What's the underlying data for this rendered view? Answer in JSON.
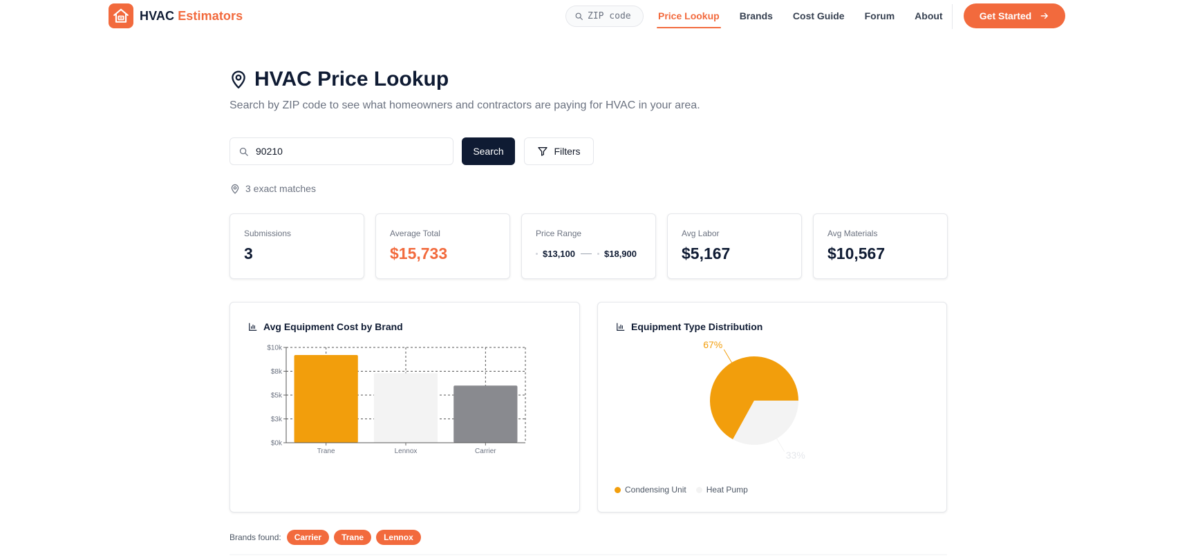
{
  "brand": {
    "name_main": "HVAC",
    "name_accent": "Estimators",
    "logo_icon": "house-icon"
  },
  "nav": {
    "zip_placeholder": "ZIP code",
    "links": [
      {
        "label": "Price Lookup",
        "active": true
      },
      {
        "label": "Brands",
        "active": false
      },
      {
        "label": "Cost Guide",
        "active": false
      },
      {
        "label": "Forum",
        "active": false
      },
      {
        "label": "About",
        "active": false
      }
    ],
    "cta_label": "Get Started"
  },
  "page": {
    "title": "HVAC Price Lookup",
    "subtitle": "Search by ZIP code to see what homeowners and contractors are paying for HVAC in your area."
  },
  "search": {
    "value": "90210",
    "button_label": "Search",
    "filters_label": "Filters"
  },
  "matches_text": "3 exact matches",
  "stats": {
    "submissions": {
      "label": "Submissions",
      "value": "3"
    },
    "average_total": {
      "label": "Average Total",
      "value": "$15,733"
    },
    "price_range": {
      "label": "Price Range",
      "min": "$13,100",
      "max": "$18,900"
    },
    "avg_labor": {
      "label": "Avg Labor",
      "value": "$5,167"
    },
    "avg_materials": {
      "label": "Avg Materials",
      "value": "$10,567"
    }
  },
  "chart_data": [
    {
      "type": "bar",
      "title": "Avg Equipment Cost by Brand",
      "categories": [
        "Trane",
        "Lennox",
        "Carrier"
      ],
      "values": [
        9200,
        7300,
        6000
      ],
      "colors": [
        "#f29e0c",
        "#f3f3f3",
        "#898a8f"
      ],
      "ylim": [
        0,
        10000
      ],
      "yticks": [
        0,
        2500,
        5000,
        7500,
        10000
      ],
      "ytick_labels": [
        "$0k",
        "$3k",
        "$5k",
        "$8k",
        "$10k"
      ],
      "grid": true,
      "xlabel": "",
      "ylabel": ""
    },
    {
      "type": "pie",
      "title": "Equipment Type Distribution",
      "labels": [
        "Condensing Unit",
        "Heat Pump"
      ],
      "values": [
        67,
        33
      ],
      "value_labels": [
        "67%",
        "33%"
      ],
      "colors": [
        "#f29e0c",
        "#f3f3f3"
      ],
      "legend": "bottom-left"
    }
  ],
  "brands_found": {
    "label": "Brands found:",
    "tags": [
      "Carrier",
      "Trane",
      "Lennox"
    ]
  },
  "colors": {
    "accent": "#f26a3d",
    "navy": "#0f1b33"
  }
}
